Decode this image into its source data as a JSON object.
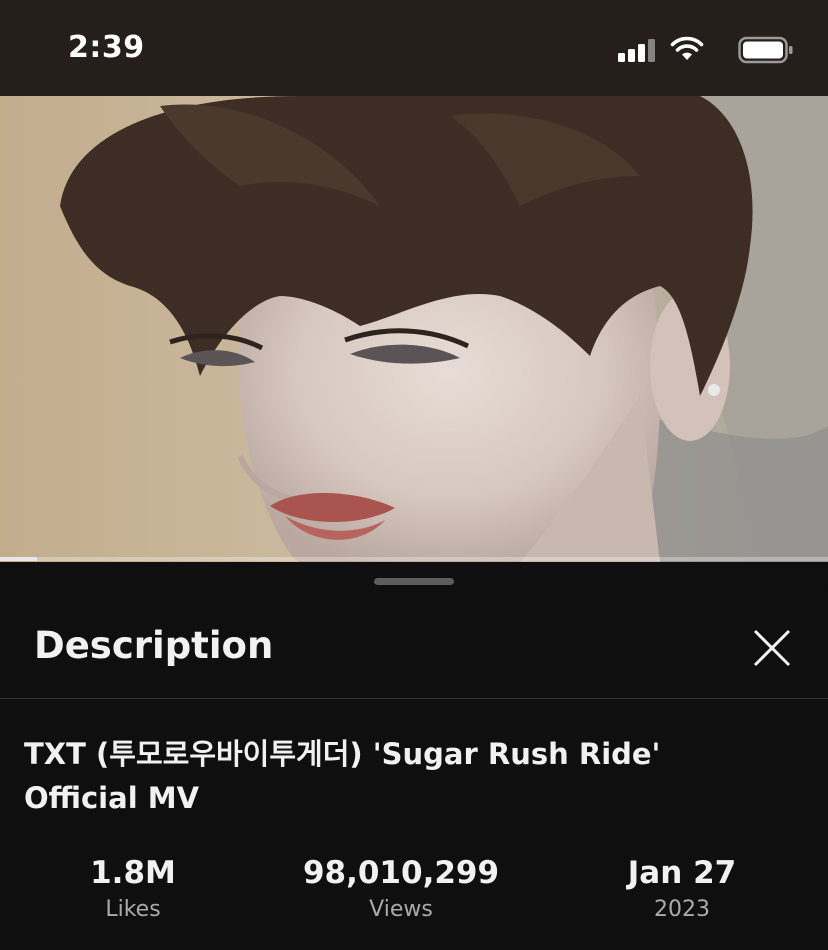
{
  "status_bar": {
    "time": "2:39",
    "icons": [
      "cellular-signal-icon",
      "wifi-icon",
      "battery-icon"
    ]
  },
  "video": {
    "playback_progress": 0.045
  },
  "description_panel": {
    "title": "Description",
    "close_icon": "close-icon",
    "video_title": "TXT (투모로우바이투게더) 'Sugar Rush Ride' Official MV",
    "stats": [
      {
        "value": "1.8M",
        "label": "Likes"
      },
      {
        "value": "98,010,299",
        "label": "Views"
      },
      {
        "value": "Jan 27",
        "label": "2023"
      }
    ]
  },
  "colors": {
    "status_bar_bg": "#251e1b",
    "sheet_bg": "#0f0f0f",
    "primary_text": "#f1f1f1",
    "secondary_text": "#aaaaaa"
  }
}
